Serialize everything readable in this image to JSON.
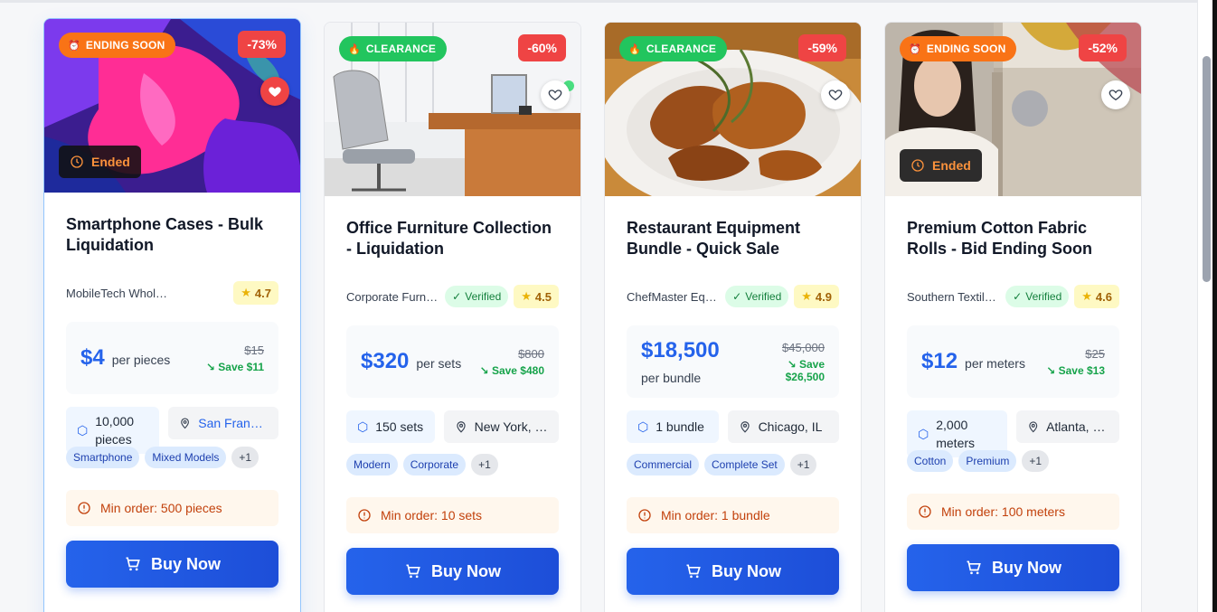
{
  "colors": {
    "accent": "#2563eb",
    "discount": "#ef4444",
    "ending": "#f97316",
    "clearance": "#22c55e"
  },
  "cards": [
    {
      "status_badge": "ENDING SOON",
      "discount": "-73%",
      "favorited": true,
      "ended_label": "Ended",
      "title": "Smartphone Cases - Bulk Liquidation",
      "seller": "MobileTech Whol…",
      "rating": "4.7",
      "price": "$4",
      "unit": "per pieces",
      "old_price": "$15",
      "save": "Save $11",
      "quantity": "10,000 pieces",
      "location": "San Franci…",
      "tags": [
        "Smartphone",
        "Mixed Models"
      ],
      "more_tags": "+1",
      "min_order": "Min order: 500 pieces",
      "buy_label": "Buy Now"
    },
    {
      "status_badge": "CLEARANCE",
      "discount": "-60%",
      "favorited": false,
      "title": "Office Furniture Collection - Liquidation",
      "seller": "Corporate Furnitu…",
      "verified": "Verified",
      "rating": "4.5",
      "price": "$320",
      "unit": "per sets",
      "old_price": "$800",
      "save": "Save $480",
      "quantity": "150 sets",
      "location": "New York, …",
      "tags": [
        "Modern",
        "Corporate"
      ],
      "more_tags": "+1",
      "min_order": "Min order: 10 sets",
      "buy_label": "Buy Now"
    },
    {
      "status_badge": "CLEARANCE",
      "discount": "-59%",
      "favorited": false,
      "title": "Restaurant Equipment Bundle - Quick Sale",
      "seller": "ChefMaster Equip…",
      "verified": "Verified",
      "rating": "4.9",
      "price": "$18,500",
      "unit": "per bundle",
      "old_price": "$45,000",
      "save": "Save $26,500",
      "quantity": "1 bundle",
      "location": "Chicago, IL",
      "tags": [
        "Commercial",
        "Complete Set"
      ],
      "more_tags": "+1",
      "min_order": "Min order: 1 bundle",
      "buy_label": "Buy Now"
    },
    {
      "status_badge": "ENDING SOON",
      "discount": "-52%",
      "favorited": false,
      "ended_label": "Ended",
      "title": "Premium Cotton Fabric Rolls - Bid Ending Soon",
      "seller": "Southern Textiles I…",
      "verified": "Verified",
      "rating": "4.6",
      "price": "$12",
      "unit": "per meters",
      "old_price": "$25",
      "save": "Save $13",
      "quantity": "2,000 meters",
      "location": "Atlanta, GA",
      "tags": [
        "Cotton",
        "Premium"
      ],
      "more_tags": "+1",
      "min_order": "Min order: 100 meters",
      "buy_label": "Buy Now"
    }
  ]
}
